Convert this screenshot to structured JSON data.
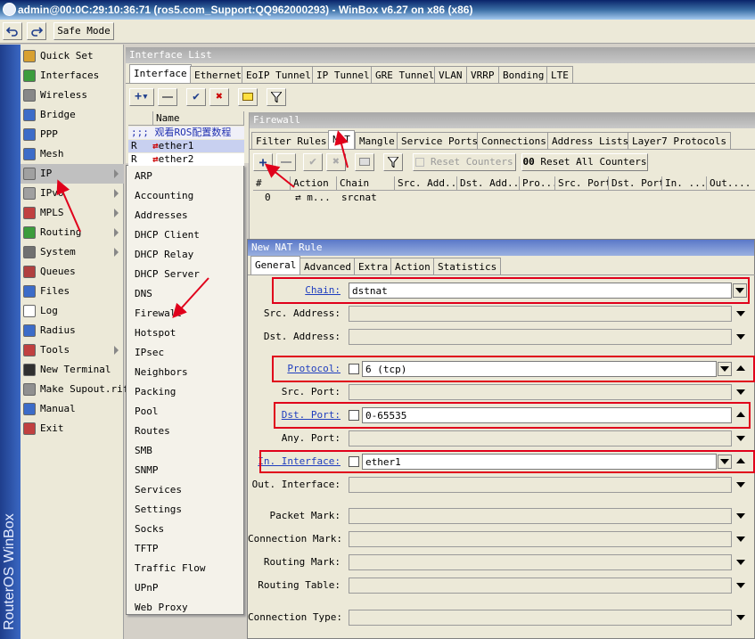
{
  "window": {
    "title": "admin@00:0C:29:10:36:71 (ros5.com_Support:QQ962000293) - WinBox v6.27 on x86 (x86)"
  },
  "toolbar": {
    "undo_icon": "undo-icon",
    "redo_icon": "redo-icon",
    "safe_mode_label": "Safe Mode"
  },
  "brand": {
    "text": "RouterOS WinBox"
  },
  "menu": {
    "items": [
      {
        "label": "Quick Set",
        "icon": "quick-set-icon",
        "color": "#d8a030"
      },
      {
        "label": "Interfaces",
        "icon": "interfaces-icon",
        "color": "#3c9c3c"
      },
      {
        "label": "Wireless",
        "icon": "wireless-icon",
        "color": "#888888"
      },
      {
        "label": "Bridge",
        "icon": "bridge-icon",
        "color": "#3c6cc8"
      },
      {
        "label": "PPP",
        "icon": "ppp-icon",
        "color": "#3c6cc8"
      },
      {
        "label": "Mesh",
        "icon": "mesh-icon",
        "color": "#3c6cc8"
      },
      {
        "label": "IP",
        "icon": "ip-icon",
        "color": "#a0a0a0"
      },
      {
        "label": "IPv6",
        "icon": "ipv6-icon",
        "color": "#a0a0a0"
      },
      {
        "label": "MPLS",
        "icon": "mpls-icon",
        "color": "#c04040"
      },
      {
        "label": "Routing",
        "icon": "routing-icon",
        "color": "#3c9c3c"
      },
      {
        "label": "System",
        "icon": "system-icon",
        "color": "#707070"
      },
      {
        "label": "Queues",
        "icon": "queues-icon",
        "color": "#b04040"
      },
      {
        "label": "Files",
        "icon": "files-icon",
        "color": "#3c6cc8"
      },
      {
        "label": "Log",
        "icon": "log-icon",
        "color": "#ffffff"
      },
      {
        "label": "Radius",
        "icon": "radius-icon",
        "color": "#3c6cc8"
      },
      {
        "label": "Tools",
        "icon": "tools-icon",
        "color": "#c04040"
      },
      {
        "label": "New Terminal",
        "icon": "terminal-icon",
        "color": "#303030"
      },
      {
        "label": "Make Supout.rif",
        "icon": "supout-icon",
        "color": "#909090"
      },
      {
        "label": "Manual",
        "icon": "manual-icon",
        "color": "#3c6cc8"
      },
      {
        "label": "Exit",
        "icon": "exit-icon",
        "color": "#c04040"
      }
    ]
  },
  "ip_submenu": {
    "items": [
      "ARP",
      "Accounting",
      "Addresses",
      "DHCP Client",
      "DHCP Relay",
      "DHCP Server",
      "DNS",
      "Firewall",
      "Hotspot",
      "IPsec",
      "Neighbors",
      "Packing",
      "Pool",
      "Routes",
      "SMB",
      "SNMP",
      "Services",
      "Settings",
      "Socks",
      "TFTP",
      "Traffic Flow",
      "UPnP",
      "Web Proxy"
    ]
  },
  "interface_list": {
    "title": "Interface List",
    "tabs": [
      "Interface",
      "Ethernet",
      "EoIP Tunnel",
      "IP Tunnel",
      "GRE Tunnel",
      "VLAN",
      "VRRP",
      "Bonding",
      "LTE"
    ],
    "column_name": "Name",
    "comment_row": ";;; 观看ROS配置数程",
    "rows": [
      {
        "flag": "R",
        "name": "ether1"
      },
      {
        "flag": "R",
        "name": "ether2"
      }
    ]
  },
  "firewall": {
    "title": "Firewall",
    "tabs": [
      "Filter Rules",
      "NAT",
      "Mangle",
      "Service Ports",
      "Connections",
      "Address Lists",
      "Layer7 Protocols"
    ],
    "reset_counters": "Reset Counters",
    "reset_all_counters_prefix": "00",
    "reset_all_counters": "Reset All Counters",
    "columns": [
      "#",
      "Action",
      "Chain",
      "Src. Add...",
      "Dst. Add...",
      "Pro...",
      "Src. Port",
      "Dst. Port",
      "In. ...",
      "Out...."
    ],
    "rows": [
      {
        "num": "0",
        "action": "m...",
        "chain": "srcnat"
      }
    ]
  },
  "nat_rule": {
    "title": "New NAT Rule",
    "tabs": [
      "General",
      "Advanced",
      "Extra",
      "Action",
      "Statistics"
    ],
    "fields": {
      "chain": {
        "label": "Chain:",
        "value": "dstnat"
      },
      "src_address": {
        "label": "Src. Address:"
      },
      "dst_address": {
        "label": "Dst. Address:"
      },
      "protocol": {
        "label": "Protocol:",
        "value": "6 (tcp)"
      },
      "src_port": {
        "label": "Src. Port:"
      },
      "dst_port": {
        "label": "Dst. Port:",
        "value": "0-65535"
      },
      "any_port": {
        "label": "Any. Port:"
      },
      "in_interface": {
        "label": "In. Interface:",
        "value": "ether1"
      },
      "out_interface": {
        "label": "Out. Interface:"
      },
      "packet_mark": {
        "label": "Packet Mark:"
      },
      "connection_mark": {
        "label": "Connection Mark:"
      },
      "routing_mark": {
        "label": "Routing Mark:"
      },
      "routing_table": {
        "label": "Routing Table:"
      },
      "connection_type": {
        "label": "Connection Type:"
      }
    }
  },
  "colors": {
    "annotation_red": "#e0001b",
    "accent_blue": "#1f3ebf"
  }
}
